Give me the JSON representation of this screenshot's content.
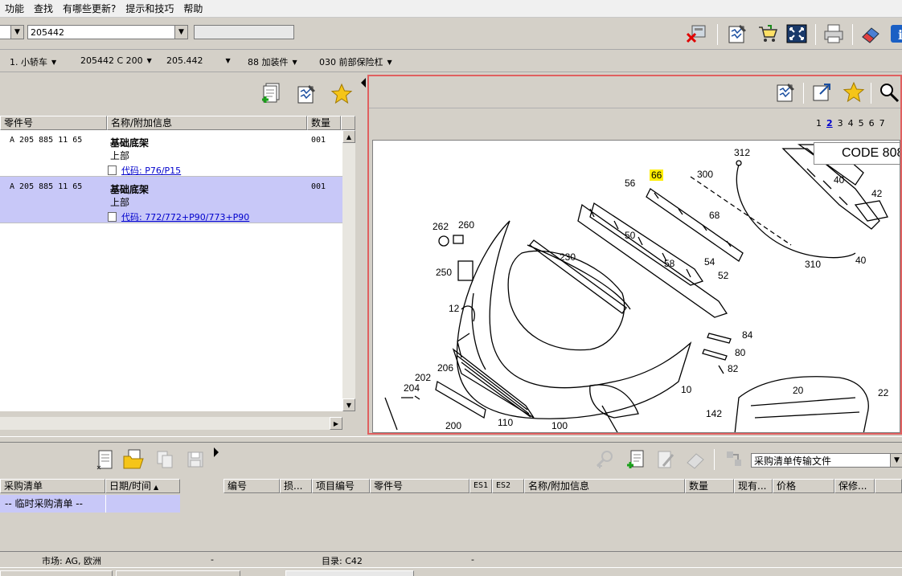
{
  "menu": [
    "功能",
    "查找",
    "有哪些更新?",
    "提示和技巧",
    "帮助"
  ],
  "toolbar": {
    "combo1_value": "",
    "combo2_value": "205442",
    "combo3_value": ""
  },
  "nav": {
    "items": [
      "1. 小轿车",
      "205442 C 200",
      "205.442",
      "88 加装件",
      "030 前部保险杠"
    ]
  },
  "parts_table": {
    "columns": [
      "零件号",
      "名称/附加信息",
      "数量"
    ],
    "rows": [
      {
        "part_no": "A 205 885 11 65",
        "name": "基础底架",
        "sub": "上部",
        "code": "代码: P76/P15",
        "qty": "001",
        "selected": false
      },
      {
        "part_no": "A 205 885 11 65",
        "name": "基础底架",
        "sub": "上部",
        "code": "代码: 772/772+P90/773+P90",
        "qty": "001",
        "selected": true
      }
    ]
  },
  "diagram": {
    "pages": [
      "1",
      "2",
      "3",
      "4",
      "5",
      "6",
      "7"
    ],
    "current_page": "2",
    "code_note": "CODE 808",
    "callouts": [
      "312",
      "66",
      "300",
      "56",
      "40",
      "42",
      "262",
      "260",
      "68",
      "50",
      "230",
      "250",
      "58",
      "54",
      "52",
      "310",
      "40",
      "12",
      "84",
      "80",
      "82",
      "206",
      "202",
      "204",
      "20",
      "10",
      "22",
      "142",
      "200",
      "110",
      "100"
    ]
  },
  "purchase_list": {
    "columns": [
      "采购清单",
      "日期/时间"
    ],
    "rows": [
      {
        "name": "-- 临时采购清单 --",
        "date": ""
      }
    ]
  },
  "order_table": {
    "transfer_select": "采购清单传输文件",
    "columns": [
      "编号",
      "损...",
      "项目编号",
      "零件号",
      "ES1",
      "ES2",
      "名称/附加信息",
      "数量",
      "现有...",
      "价格",
      "保修..."
    ]
  },
  "status": {
    "market": "市场: AG, 欧洲",
    "sep1": "-",
    "catalog": "目录: C42",
    "sep2": "-"
  },
  "colors": {
    "selected_row": "#c8c8f8",
    "highlight": "#ffee00",
    "active_border": "#e06060",
    "link": "#0000cc"
  }
}
